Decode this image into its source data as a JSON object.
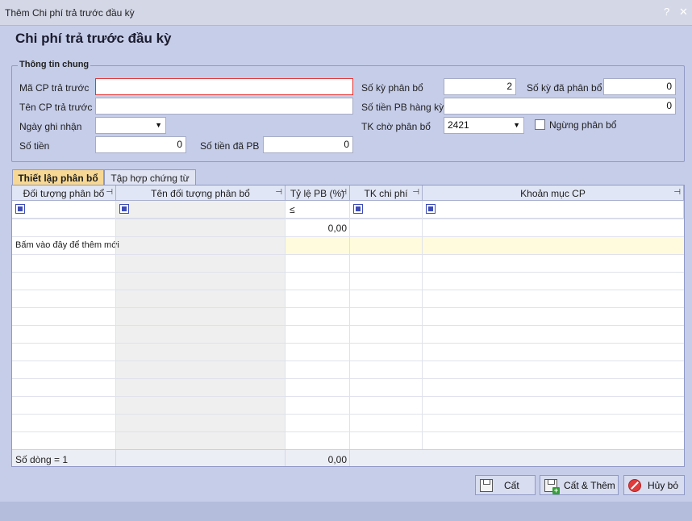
{
  "window": {
    "title": "Thêm Chi phí trả trước đầu kỳ",
    "help_glyph": "?",
    "close_glyph": "✕"
  },
  "page_title": "Chi phí trả trước đầu kỳ",
  "general": {
    "group_title": "Thông tin chung",
    "ma_cp_label": "Mã CP trả trước",
    "ma_cp_value": "",
    "ten_cp_label": "Tên CP trả trước",
    "ten_cp_value": "",
    "ngay_label": "Ngày ghi nhận",
    "ngay_value": "",
    "so_tien_label": "Số tiền",
    "so_tien_value": "0",
    "so_tien_da_pb_label": "Số tiền đã PB",
    "so_tien_da_pb_value": "0",
    "so_ky_pb_label": "Số kỳ phân bổ",
    "so_ky_pb_value": "2",
    "so_ky_da_pb_label": "Số kỳ đã phân bổ",
    "so_ky_da_pb_value": "0",
    "so_tien_pb_hang_ky_label": "Số tiền PB hàng kỳ",
    "so_tien_pb_hang_ky_value": "0",
    "tk_cho_pb_label": "TK chờ phân bổ",
    "tk_cho_pb_value": "2421",
    "ngung_pb_label": "Ngừng phân bổ",
    "ngung_pb_checked": false
  },
  "tabs": [
    {
      "label": "Thiết lập phân bổ",
      "active": true
    },
    {
      "label": "Tập hợp chứng từ",
      "active": false
    }
  ],
  "grid": {
    "columns": [
      {
        "label": "Đối tượng phân bổ"
      },
      {
        "label": "Tên đối tượng phân bổ"
      },
      {
        "label": "Tỷ lệ PB (%)"
      },
      {
        "label": "TK chi phí"
      },
      {
        "label": "Khoản mục CP"
      }
    ],
    "pin_glyph": "⊣",
    "filter_operator": "≤",
    "summary_ratio_top": "0,00",
    "new_row_text": "Bấm vào đây để thêm mới",
    "footer_count": "Số dòng = 1",
    "footer_ratio_total": "0,00"
  },
  "buttons": {
    "save": "Cất",
    "save_add": "Cất & Thêm",
    "cancel": "Hủy bỏ"
  },
  "icons": [
    "help-icon",
    "close-icon",
    "dropdown-arrow-icon",
    "pin-icon",
    "filter-checkbox-icon",
    "save-icon",
    "save-add-icon",
    "cancel-icon"
  ]
}
